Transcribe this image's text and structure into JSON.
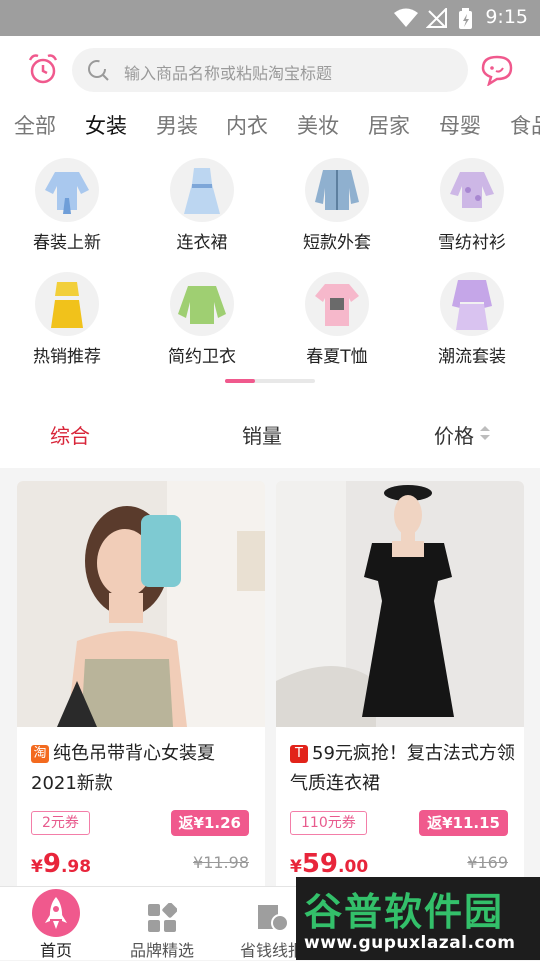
{
  "status_bar": {
    "time": "9:15"
  },
  "search": {
    "placeholder": "输入商品名称或粘贴淘宝标题"
  },
  "tabs": [
    "全部",
    "女装",
    "男装",
    "内衣",
    "美妆",
    "居家",
    "母婴",
    "食品"
  ],
  "active_tab": "女装",
  "categories": [
    {
      "label": "春装上新",
      "icon": "blouse-icon"
    },
    {
      "label": "连衣裙",
      "icon": "dress-icon"
    },
    {
      "label": "短款外套",
      "icon": "denim-jacket-icon"
    },
    {
      "label": "雪纺衬衫",
      "icon": "chiffon-shirt-icon"
    },
    {
      "label": "热销推荐",
      "icon": "yellow-set-icon"
    },
    {
      "label": "简约卫衣",
      "icon": "sweater-icon"
    },
    {
      "label": "春夏T恤",
      "icon": "tshirt-icon"
    },
    {
      "label": "潮流套装",
      "icon": "suit-icon"
    }
  ],
  "sort": {
    "comprehensive": "综合",
    "sales": "销量",
    "price": "价格"
  },
  "products": [
    {
      "platform_badge": "淘",
      "title": "纯色吊带背心女装夏2021新款",
      "coupon": "2元券",
      "rebate": "返¥1.26",
      "price_symbol": "¥",
      "price_int": "9",
      "price_dec": ".98",
      "original_price": "¥11.98"
    },
    {
      "platform_badge": "T",
      "title": "59元疯抢！复古法式方领气质连衣裙",
      "coupon": "110元券",
      "rebate": "返¥11.15",
      "price_symbol": "¥",
      "price_int": "59",
      "price_dec": ".00",
      "original_price": "¥169"
    }
  ],
  "nav": {
    "home": "首页",
    "brands": "品牌精选",
    "save": "省钱线报"
  },
  "watermark": {
    "title": "谷普软件园",
    "url": "www.gupuxlazal.com"
  },
  "colors": {
    "accent": "#e8253b",
    "pink": "#f0598d",
    "sort_active": "#d8263a"
  }
}
